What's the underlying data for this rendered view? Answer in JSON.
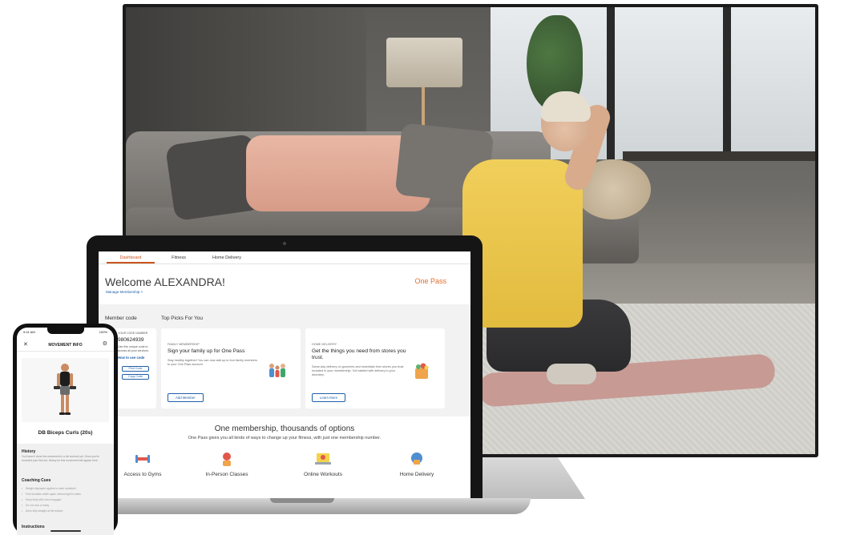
{
  "laptop": {
    "nav": [
      "Dashboard",
      "Fitness",
      "Home Delivery"
    ],
    "welcome": "Welcome ALEXANDRA!",
    "manage_link": "Manage Membership >",
    "brand": "One Pass",
    "member_section": "Member code",
    "picks_section": "Top Picks For You",
    "member_card": {
      "label": "YOUR CODE NUMBER",
      "number": "980624939",
      "desc": "Use this unique code to access all your services.",
      "link": "How to use code",
      "print_btn": "Print Code",
      "copy_btn": "Copy Code"
    },
    "picks": [
      {
        "eyebrow": "FAMILY MEMBERSHIP",
        "title": "Sign your family up for One Pass",
        "desc": "Stay healthy together! You can now add up to four family members to your One Pass account.",
        "button": "Add Member"
      },
      {
        "eyebrow": "HOME DELIVERY",
        "title": "Get the things you need from stores you trust.",
        "desc": "Same-day delivery on groceries and essentials from stores you trust included in your membership. Get started with delivery to your doorstep.",
        "button": "Learn More"
      }
    ],
    "hero_title": "One membership, thousands of options",
    "hero_sub": "One Pass gives you all kinds of ways to change up your fitness, with just one membership number.",
    "features": [
      "Access to Gyms",
      "In-Person Classes",
      "Online Workouts",
      "Home Delivery"
    ]
  },
  "phone": {
    "time": "9:41 AM",
    "battery": "100%",
    "title": "MOVEMENT INFO",
    "exercise": "DB Biceps Curls (20s)",
    "history_heading": "History",
    "history_text": "You haven't done this movement in a full workout yet. Once you've recorded your first set, history for this movement will appear here.",
    "cues_heading": "Coaching Cues",
    "cues": [
      "Weight displayed applies to each dumbbell",
      "Feet shoulder-width apart; elbows tight to sides",
      "Keep body still, torso engaged",
      "Do not rock or sway",
      "Arms fully straight at the bottom"
    ],
    "instructions_heading": "Instructions"
  },
  "colors": {
    "accent": "#c9541f",
    "brand": "#e46b2a",
    "link": "#1f5fa8"
  }
}
